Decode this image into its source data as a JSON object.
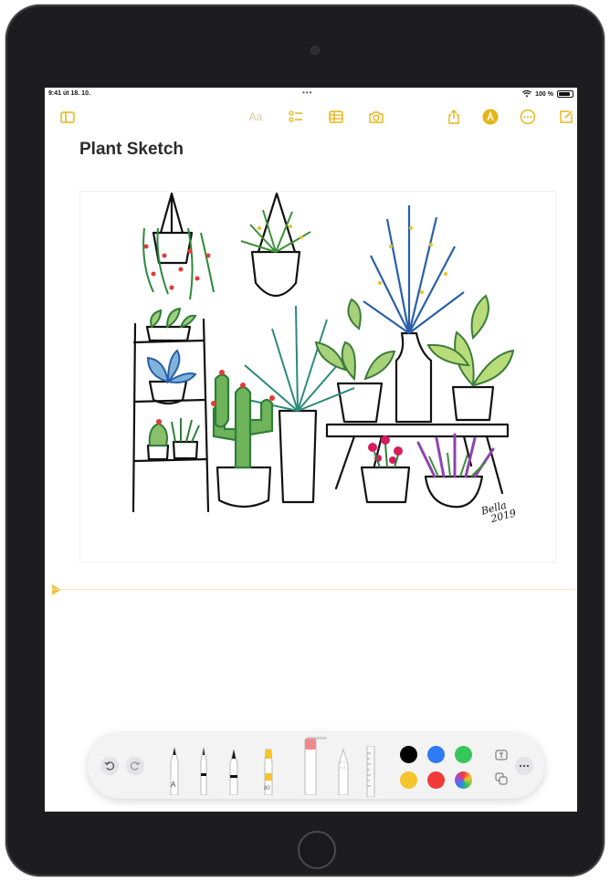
{
  "status": {
    "time_date": "9:41 út 18. 10.",
    "battery": "100 %"
  },
  "toolbar": {
    "format_label": "Aa"
  },
  "note": {
    "title": "Plant Sketch",
    "signature_line1": "Bella",
    "signature_line2": "2019"
  },
  "palette": {
    "pencil_tip_label": "A",
    "marker_label": "80",
    "colors": [
      "#000000",
      "#2f7bf6",
      "#37c759",
      "#f6c42c",
      "#f03a3a"
    ],
    "accent": "#e7b416"
  }
}
